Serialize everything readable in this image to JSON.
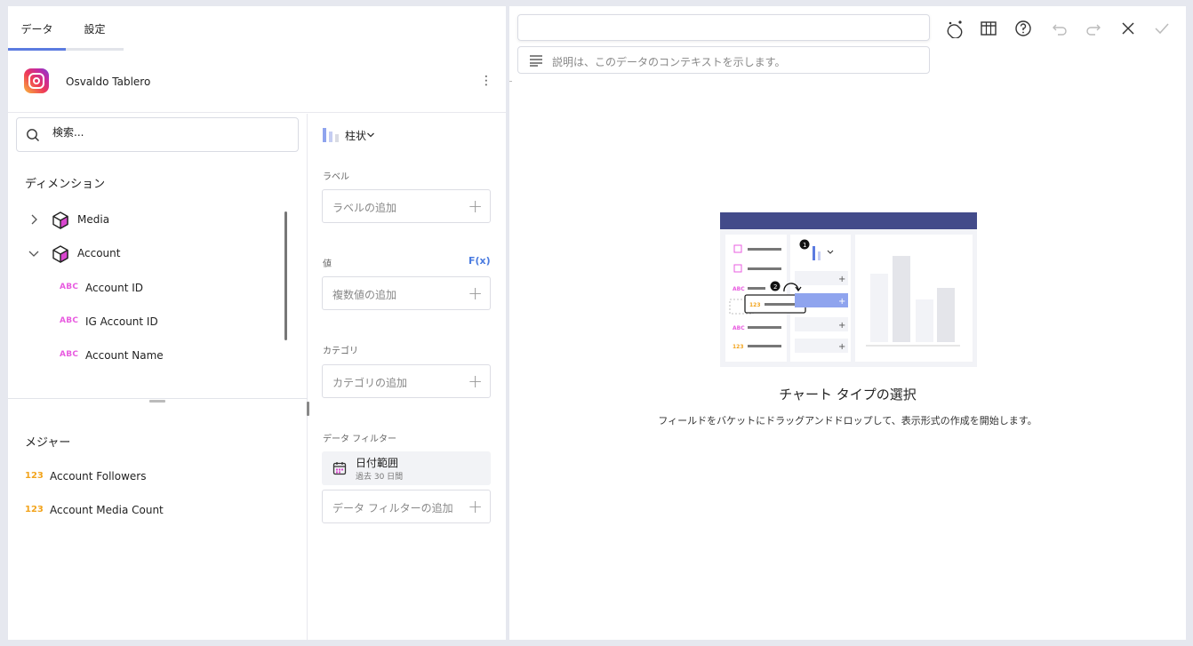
{
  "tabs": [
    {
      "label": "データ",
      "active": true
    },
    {
      "label": "設定",
      "active": false
    }
  ],
  "source": {
    "name": "Osvaldo Tablero",
    "icon": "instagram-logo-icon"
  },
  "search": {
    "placeholder": "検索..."
  },
  "dimensions": {
    "title": "ディメンション",
    "items": [
      {
        "label": "Media",
        "expanded": false
      },
      {
        "label": "Account",
        "expanded": true
      }
    ],
    "fields": [
      {
        "type": "ABC",
        "label": "Account ID"
      },
      {
        "type": "ABC",
        "label": "IG Account ID"
      },
      {
        "type": "ABC",
        "label": "Account Name"
      }
    ]
  },
  "measures": {
    "title": "メジャー",
    "items": [
      {
        "type": "123",
        "label": "Account Followers"
      },
      {
        "type": "123",
        "label": "Account Media Count"
      }
    ]
  },
  "buckets": {
    "chart_type": "柱状",
    "label_title": "ラベル",
    "label_placeholder": "ラベルの追加",
    "value_title": "値",
    "fx": "F(x)",
    "value_placeholder": "複数値の追加",
    "category_title": "カテゴリ",
    "category_placeholder": "カテゴリの追加",
    "filter_title": "データ フィルター",
    "filter": {
      "title": "日付範囲",
      "subtitle": "過去 30 日間"
    },
    "filter_placeholder": "データ フィルターの追加"
  },
  "editor": {
    "title_value": "",
    "description_placeholder": "説明は、このデータのコンテキストを示します。",
    "toolbar": [
      "ai-assist-icon",
      "table-icon",
      "help-icon",
      "undo-icon",
      "redo-icon",
      "close-icon",
      "check-icon"
    ],
    "illustration": {
      "badge_1": "1",
      "badge_2": "2",
      "abc": "ABC",
      "num": "123"
    },
    "empty_title": "チャート タイプの選択",
    "empty_subtitle": "フィールドをバケットにドラッグアンドドロップして、表示形式の作成を開始します。"
  },
  "colors": {
    "accent": "#5b7be0",
    "abc": "#e85ce0",
    "num": "#f2a41d",
    "fx": "#4a7be0",
    "illus_header": "#434b8a"
  }
}
